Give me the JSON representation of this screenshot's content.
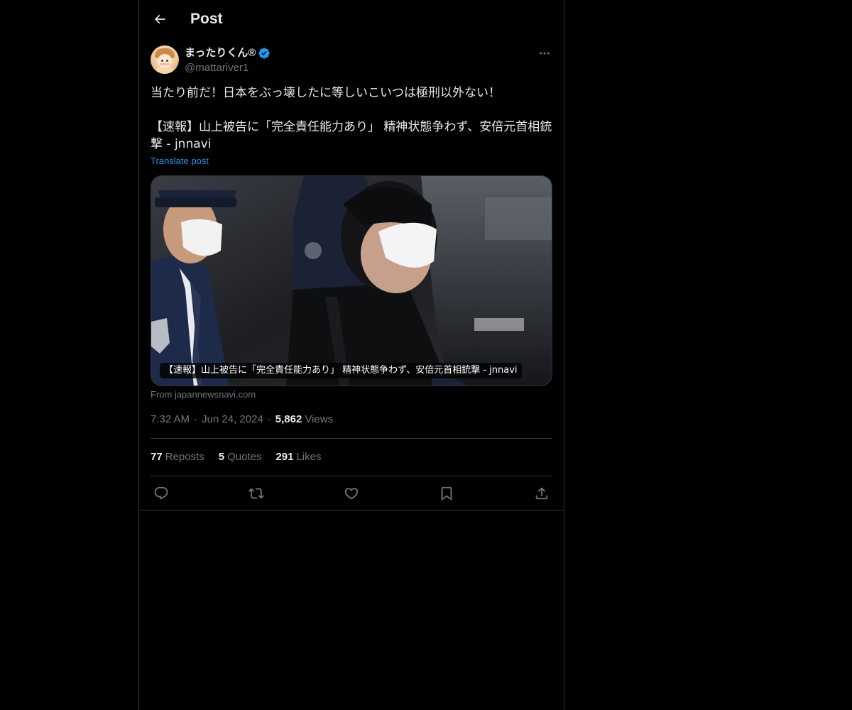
{
  "header": {
    "title": "Post"
  },
  "author": {
    "display_name": "まったりくん®",
    "handle": "@mattariver1",
    "verified": true
  },
  "post": {
    "line1": "当たり前だ！日本をぶっ壊したに等しいこいつは極刑以外ない！",
    "line2": "【速報】山上被告に「完全責任能力あり」 精神状態争わず、安倍元首相銃撃 - jnnavi",
    "translate_label": "Translate post"
  },
  "card": {
    "caption": "【速報】山上被告に「完全責任能力あり」 精神状態争わず、安倍元首相銃撃 - jnnavi",
    "source": "From japannewsnavi.com"
  },
  "meta": {
    "time": "7:32 AM",
    "date": "Jun 24, 2024",
    "views_count": "5,862",
    "views_label": "Views"
  },
  "stats": {
    "reposts_count": "77",
    "reposts_label": "Reposts",
    "quotes_count": "5",
    "quotes_label": "Quotes",
    "likes_count": "291",
    "likes_label": "Likes"
  },
  "colors": {
    "background": "#000000",
    "text_primary": "#e7e9ea",
    "text_secondary": "#71767b",
    "accent": "#1d9bf0",
    "border": "#2f3336"
  },
  "icons": {
    "back": "arrow-left-icon",
    "verified": "verified-badge-icon",
    "more": "more-horizontal-icon",
    "reply": "reply-icon",
    "repost": "repost-icon",
    "like": "heart-icon",
    "bookmark": "bookmark-icon",
    "share": "share-icon"
  }
}
